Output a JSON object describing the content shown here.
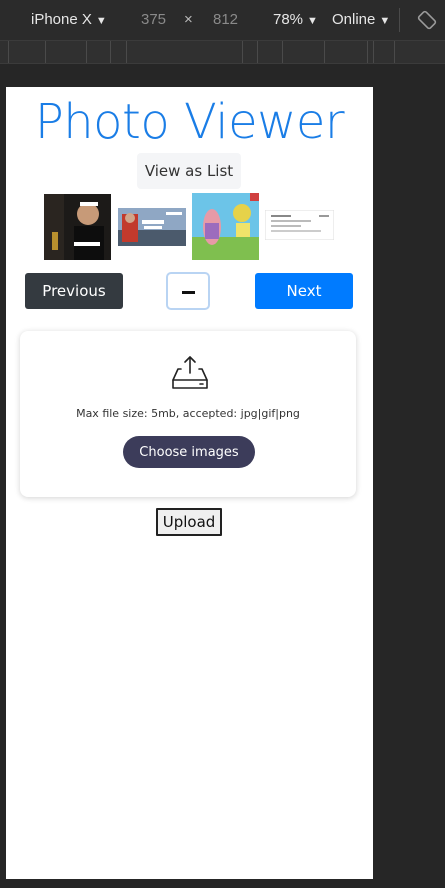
{
  "devtools": {
    "device": "iPhone X",
    "width": "375",
    "times": "×",
    "height": "812",
    "zoom": "78%",
    "network": "Online",
    "caret": "▼"
  },
  "page": {
    "title": "Photo Viewer",
    "view_toggle_label": "View as List",
    "previous_label": "Previous",
    "next_label": "Next",
    "upload_card": {
      "limits_text": "Max file size: 5mb, accepted: jpg|gif|png",
      "choose_label": "Choose images"
    },
    "upload_label": "Upload"
  },
  "colors": {
    "title": "#1a7de6",
    "next_button": "#007bff",
    "previous_button": "#343a40",
    "choose_button": "#3c3c5a"
  },
  "icons": {
    "minus": "minus-icon",
    "upload": "upload-tray-icon",
    "rotate": "rotate-icon"
  }
}
